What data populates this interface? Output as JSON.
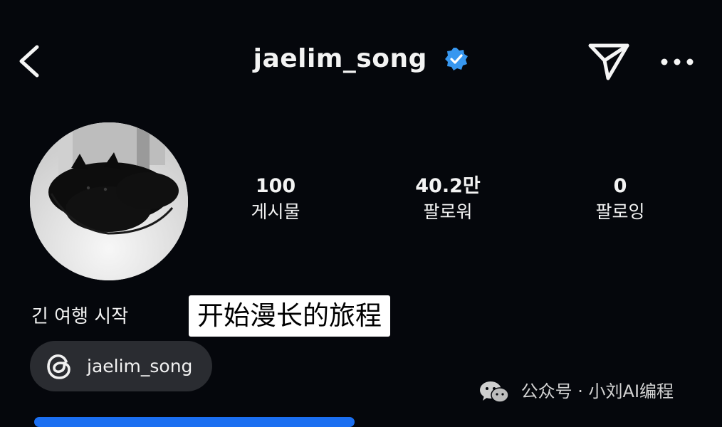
{
  "header": {
    "username": "jaelim_song",
    "back_icon": "chevron-left-icon",
    "verified_icon": "verified-badge-icon",
    "verified_color": "#3797f0",
    "send_icon": "paper-plane-icon",
    "more_icon": "more-horizontal-icon"
  },
  "profile": {
    "avatar_icon": "black-cat-photo",
    "stats": [
      {
        "value": "100",
        "label": "게시물"
      },
      {
        "value": "40.2만",
        "label": "팔로워"
      },
      {
        "value": "0",
        "label": "팔로잉"
      }
    ],
    "bio": "긴 여행 시작",
    "caption_overlay": "开始漫长的旅程",
    "threads": {
      "icon": "threads-icon",
      "label": "jaelim_song"
    }
  },
  "watermark": {
    "icon": "wechat-icon",
    "text": "公众号 · 小刘AI编程"
  },
  "colors": {
    "background": "#05070c",
    "pill": "#2a2c31",
    "accent_bar": "#1b6ff1"
  }
}
